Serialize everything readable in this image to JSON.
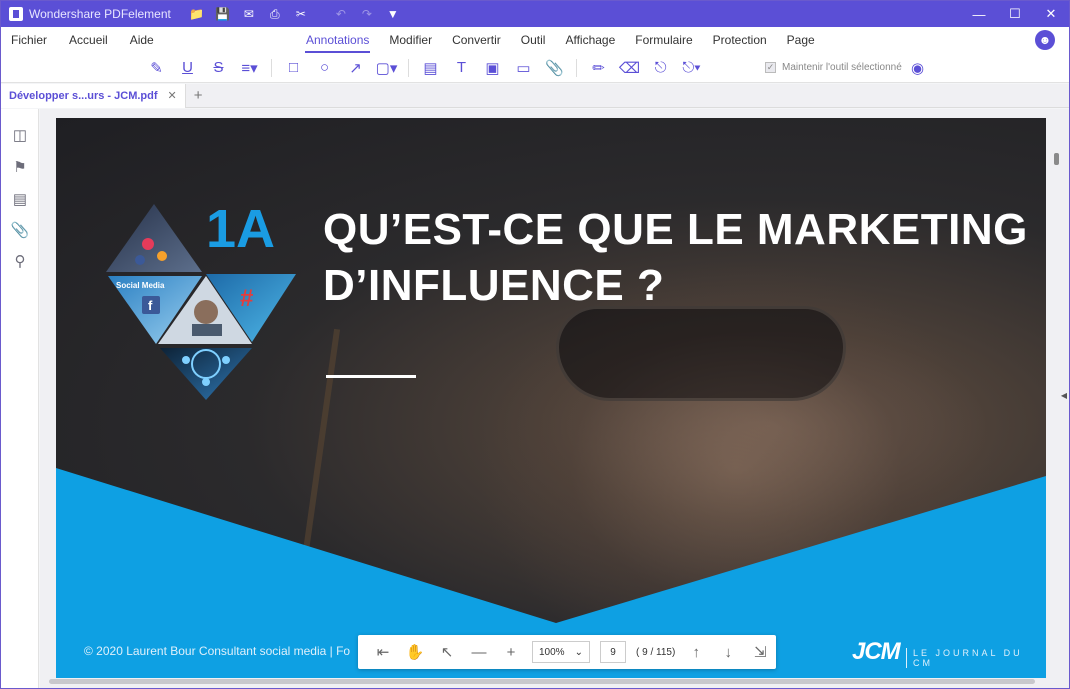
{
  "app": {
    "title": "Wondershare PDFelement"
  },
  "quick_access": [
    "folder-open-icon",
    "save-icon",
    "email-icon",
    "print-icon",
    "scissors-icon",
    "undo-icon",
    "redo-icon",
    "dropdown-icon"
  ],
  "menu": {
    "left": [
      "Fichier",
      "Accueil",
      "Aide"
    ],
    "tabs": [
      "Annotations",
      "Modifier",
      "Convertir",
      "Outil",
      "Affichage",
      "Formulaire",
      "Protection",
      "Page"
    ],
    "active_tab": "Annotations"
  },
  "toolbar": {
    "keep_tool_label": "Maintenir l'outil sélectionné",
    "keep_tool_checked": true
  },
  "document_tab": {
    "name": "Développer s...urs - JCM.pdf"
  },
  "slide": {
    "number": "1A",
    "title_line1": "QU’EST-CE QUE LE MARKETING",
    "title_line2": "D’INFLUENCE ?",
    "footer": "© 2020 Laurent Bour  Consultant social media  |  Fo",
    "logo": "JCM",
    "tagline": "LE JOURNAL DU CM",
    "collage_text": "Social Media"
  },
  "zoom_bar": {
    "zoom": "100%",
    "page": "9",
    "page_count": "( 9 / 115)"
  },
  "colors": {
    "accent": "#5b4fd6",
    "slide_blue": "#0ea0e3"
  }
}
